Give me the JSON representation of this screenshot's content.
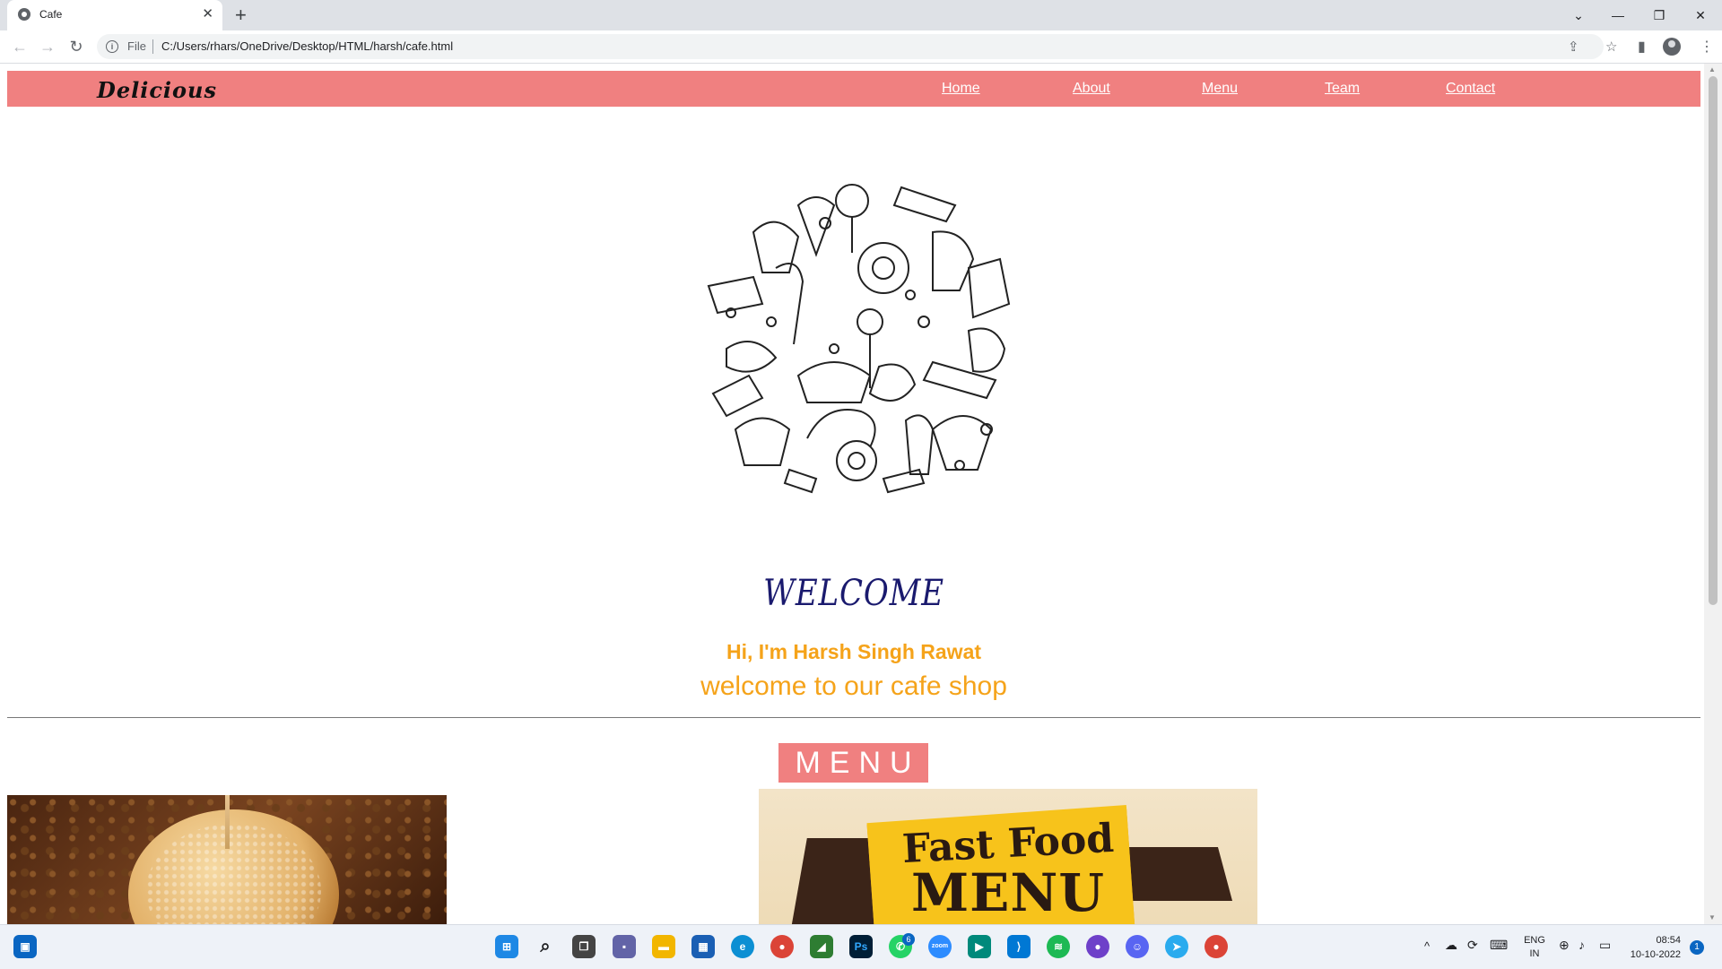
{
  "browser": {
    "tab_title": "Cafe",
    "new_tab": "+",
    "file_label": "File",
    "url": "C:/Users/rhars/OneDrive/Desktop/HTML/harsh/cafe.html"
  },
  "site": {
    "brand": "Delicious",
    "nav": [
      "Home",
      "About",
      "Menu",
      "Team",
      "Contact"
    ],
    "welcome": "WELCOME",
    "intro": "Hi, I'm Harsh Singh Rawat",
    "tagline": "welcome to our cafe shop",
    "menu_heading": "MENU",
    "menu_image": {
      "line1": "Fast Food",
      "line2": "MENU"
    }
  },
  "taskbar": {
    "whatsapp_badge": "6",
    "zoom_label": "zoom",
    "lang_line1": "ENG",
    "lang_line2": "IN",
    "time": "08:54",
    "date": "10-10-2022",
    "notification_count": "1"
  },
  "colors": {
    "nav_bg": "#f08080",
    "accent_orange": "#f5a31a",
    "welcome_navy": "#1a1a6e"
  }
}
